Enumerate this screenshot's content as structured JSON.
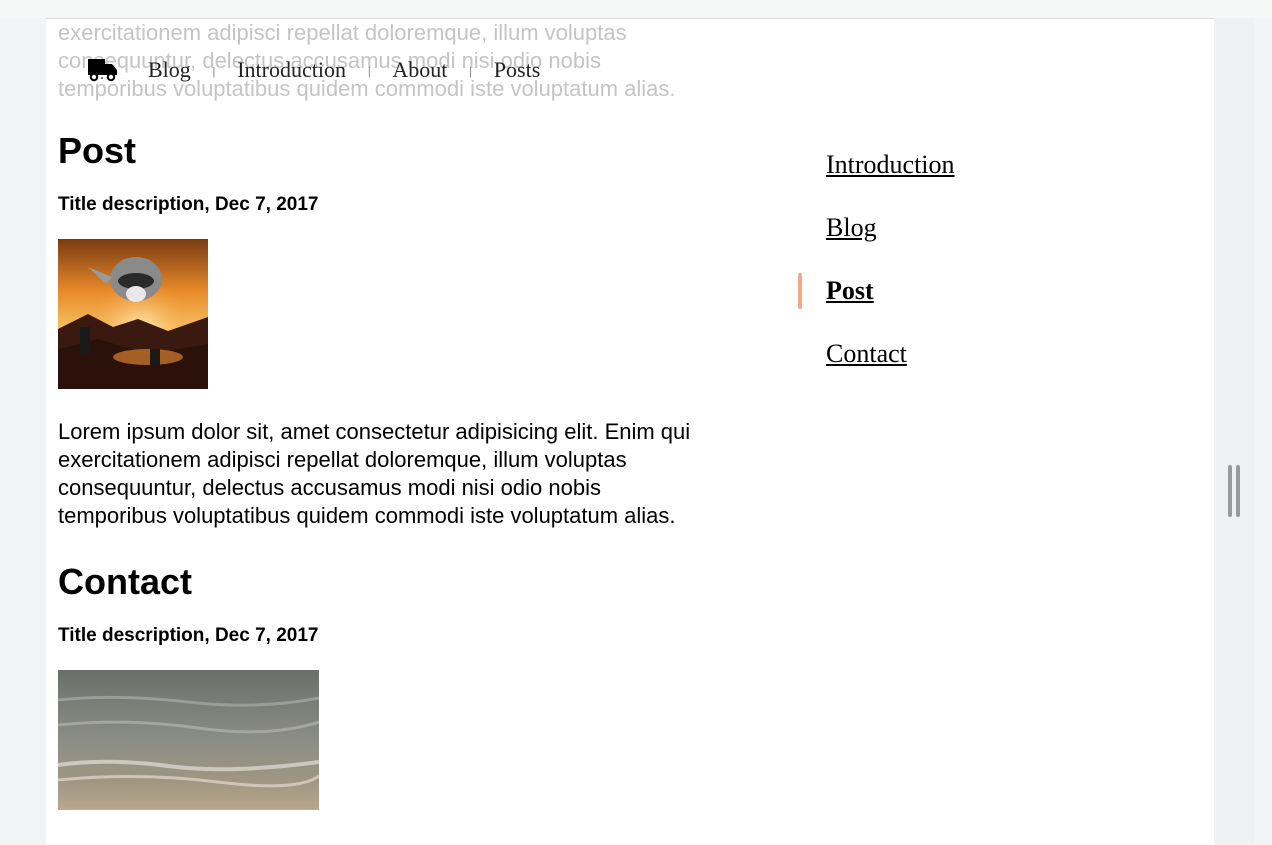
{
  "faded_paragraph": {
    "lines": [
      "exercitationem adipisci repellat doloremque, illum voluptas",
      "consequuntur, delectus accusamus modi nisi odio nobis",
      "temporibus voluptatibus quidem commodi iste voluptatum alias."
    ]
  },
  "topnav": {
    "logo_icon": "truck-icon",
    "items": [
      "Blog",
      "Introduction",
      "About",
      "Posts"
    ],
    "separator": "|"
  },
  "sections": [
    {
      "title": "Post",
      "subtitle": "Title description, Dec 7, 2017",
      "image": "raccoon-sunset-image",
      "paragraph_lines": [
        "Lorem ipsum dolor sit, amet consectetur adipisicing elit. Enim qui",
        "exercitationem adipisci repellat doloremque, illum voluptas",
        "consequuntur, delectus accusamus modi nisi odio nobis",
        "temporibus voluptatibus quidem commodi iste voluptatum alias."
      ]
    },
    {
      "title": "Contact",
      "subtitle": "Title description, Dec 7, 2017",
      "image": "beach-waves-image"
    }
  ],
  "sidenav": {
    "items": [
      "Introduction",
      "Blog",
      "Post",
      "Contact"
    ],
    "active": "Post",
    "active_indicator_color": "#f0a98a"
  }
}
